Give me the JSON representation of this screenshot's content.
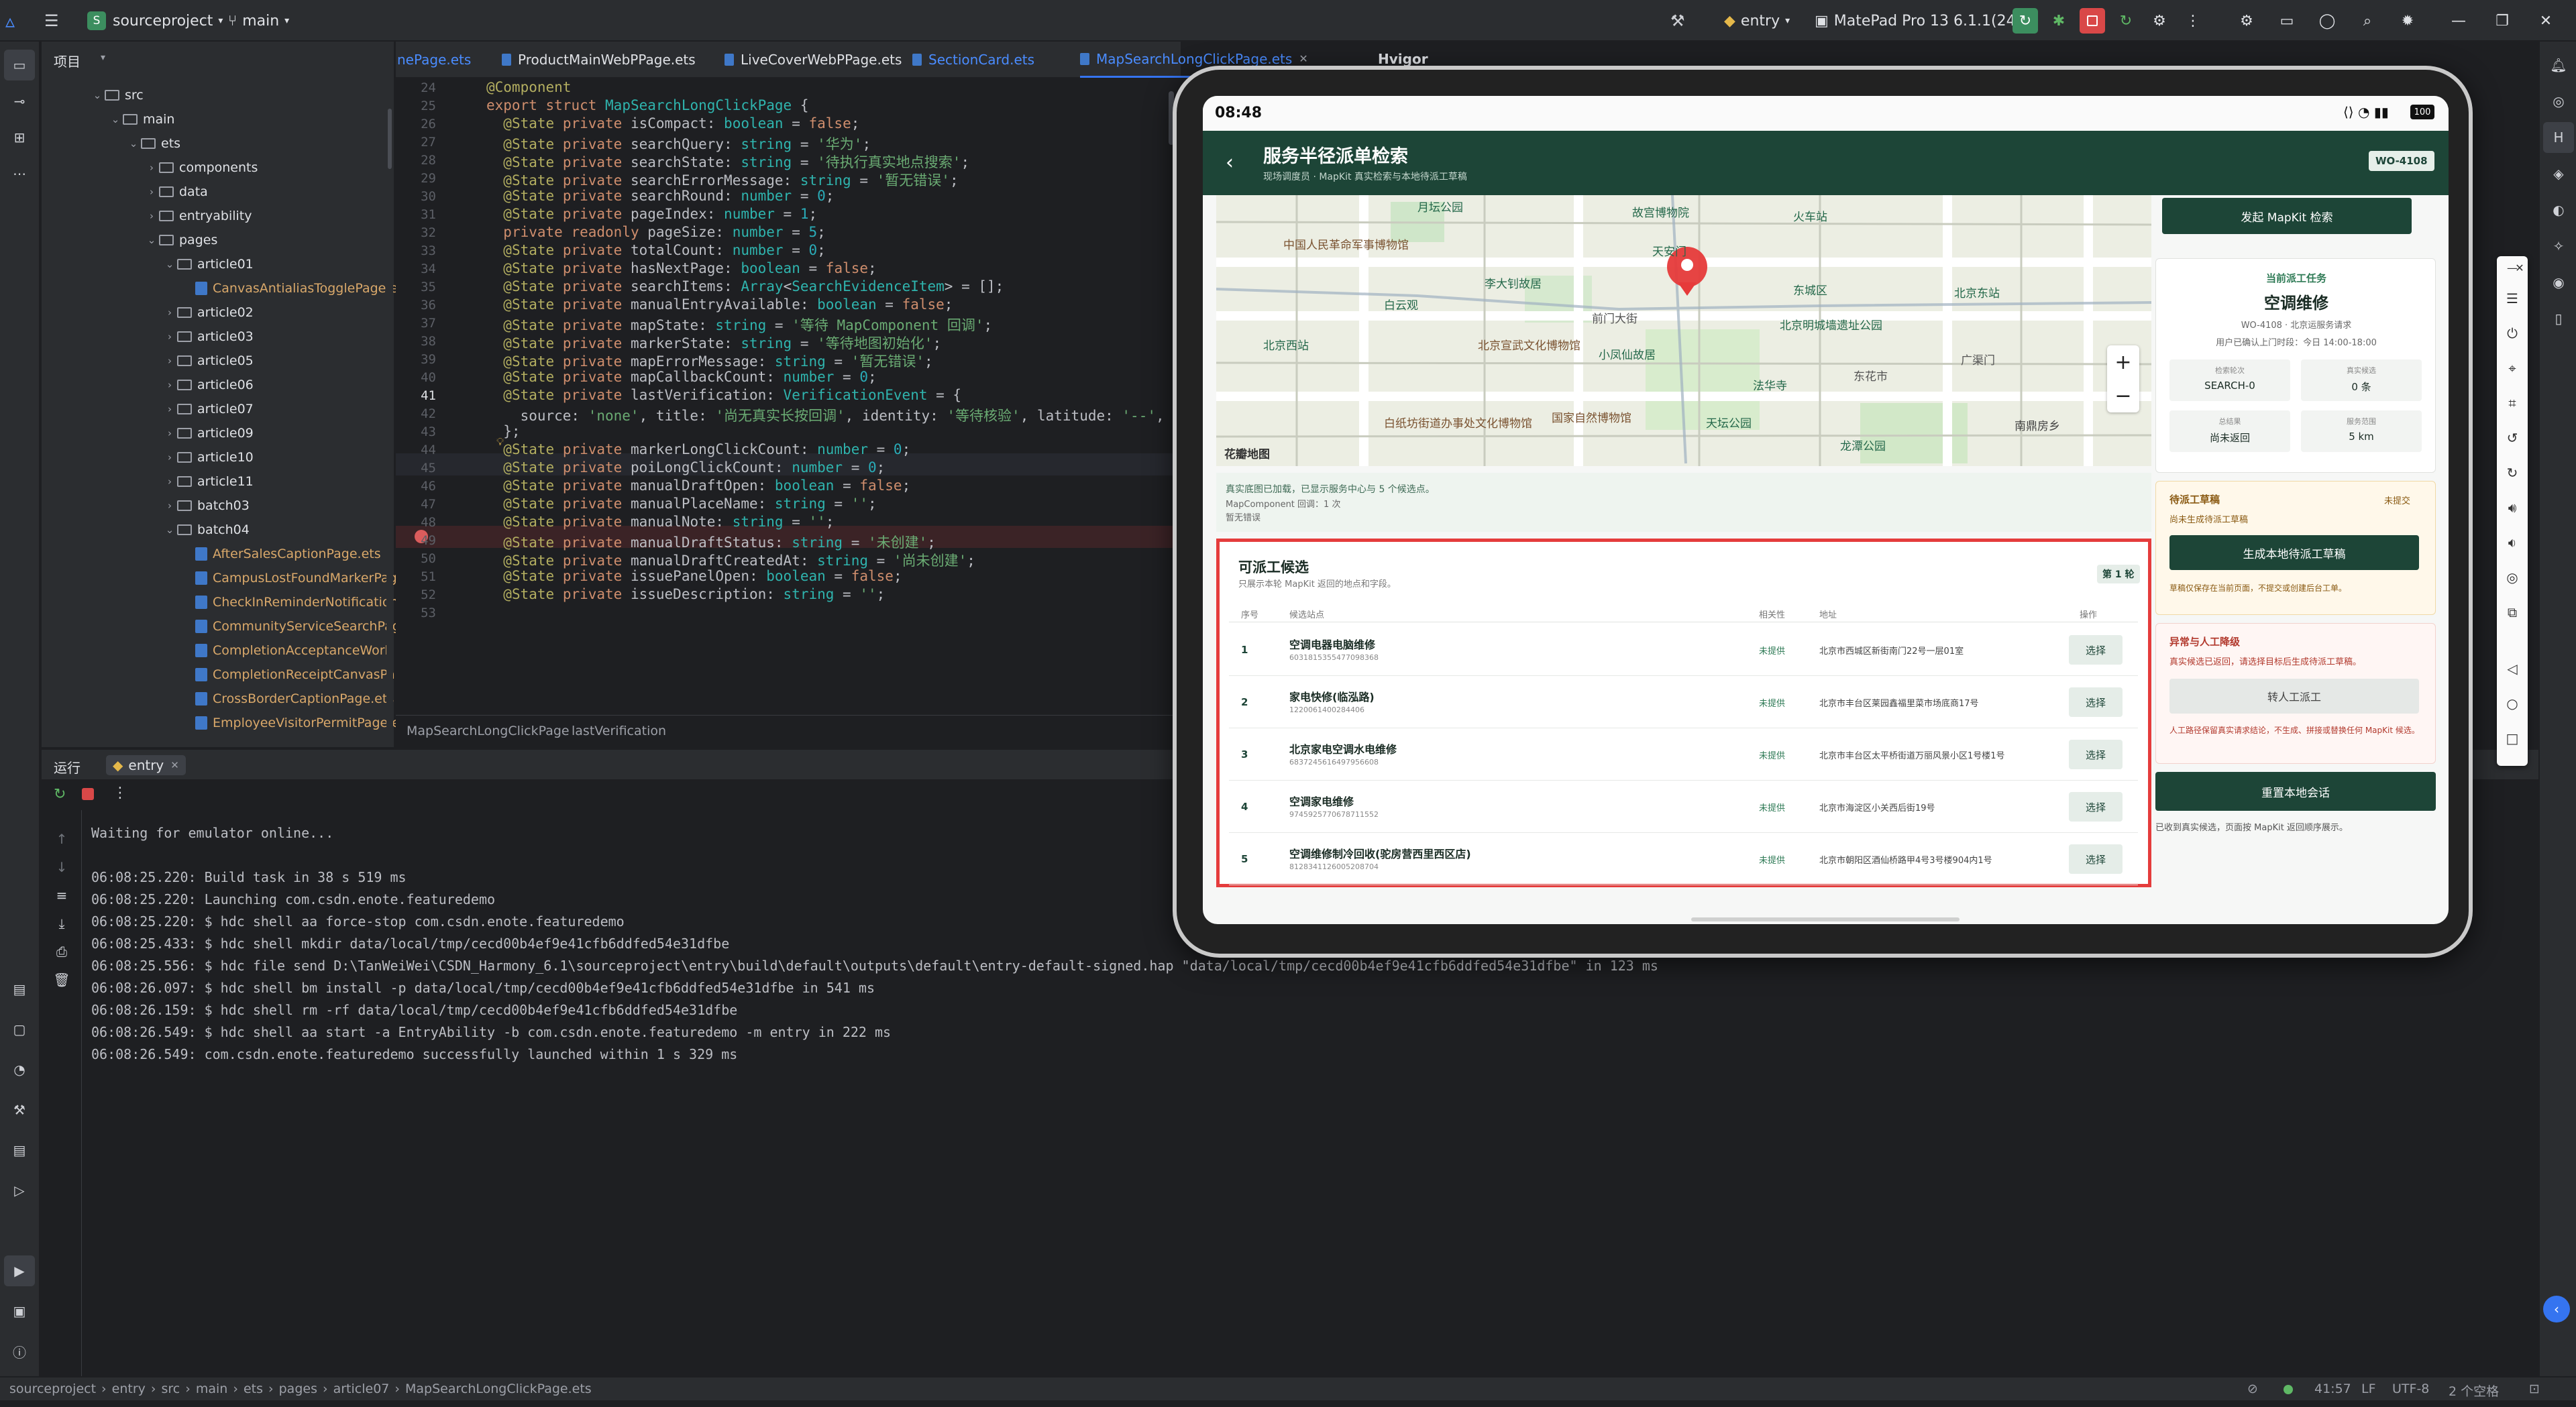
{
  "titlebar": {
    "project": "sourceproject",
    "project_badge": "S",
    "branch": "main",
    "run_config": "entry",
    "device": "MatePad Pro 13 6.1.1(24)"
  },
  "project_panel": {
    "title": "项目",
    "tree": [
      {
        "label": "src",
        "depth": 0,
        "type": "folder",
        "open": true
      },
      {
        "label": "main",
        "depth": 1,
        "type": "folder",
        "open": true
      },
      {
        "label": "ets",
        "depth": 2,
        "type": "folder",
        "open": true
      },
      {
        "label": "components",
        "depth": 3,
        "type": "folder"
      },
      {
        "label": "data",
        "depth": 3,
        "type": "folder"
      },
      {
        "label": "entryability",
        "depth": 3,
        "type": "folder"
      },
      {
        "label": "pages",
        "depth": 3,
        "type": "folder",
        "open": true
      },
      {
        "label": "article01",
        "depth": 4,
        "type": "folder",
        "open": true
      },
      {
        "label": "CanvasAntialiasTogglePage.e",
        "depth": 5,
        "type": "file"
      },
      {
        "label": "article02",
        "depth": 4,
        "type": "folder"
      },
      {
        "label": "article03",
        "depth": 4,
        "type": "folder"
      },
      {
        "label": "article05",
        "depth": 4,
        "type": "folder"
      },
      {
        "label": "article06",
        "depth": 4,
        "type": "folder"
      },
      {
        "label": "article07",
        "depth": 4,
        "type": "folder"
      },
      {
        "label": "article09",
        "depth": 4,
        "type": "folder"
      },
      {
        "label": "article10",
        "depth": 4,
        "type": "folder"
      },
      {
        "label": "article11",
        "depth": 4,
        "type": "folder"
      },
      {
        "label": "batch03",
        "depth": 4,
        "type": "folder"
      },
      {
        "label": "batch04",
        "depth": 4,
        "type": "folder",
        "open": true
      },
      {
        "label": "AfterSalesCaptionPage.ets",
        "depth": 5,
        "type": "file"
      },
      {
        "label": "CampusLostFoundMarkerPag",
        "depth": 5,
        "type": "file"
      },
      {
        "label": "CheckInReminderNotification",
        "depth": 5,
        "type": "file"
      },
      {
        "label": "CommunityServiceSearchPag",
        "depth": 5,
        "type": "file"
      },
      {
        "label": "CompletionAcceptanceWork",
        "depth": 5,
        "type": "file"
      },
      {
        "label": "CompletionReceiptCanvasPa",
        "depth": 5,
        "type": "file"
      },
      {
        "label": "CrossBorderCaptionPage.ets",
        "depth": 5,
        "type": "file"
      },
      {
        "label": "EmployeeVisitorPermitPage.e",
        "depth": 5,
        "type": "file"
      }
    ]
  },
  "tabs": [
    "nePage.ets",
    "ProductMainWebPPage.ets",
    "LiveCoverWebPPage.ets",
    "SectionCard.ets",
    "MapSearchLongClickPage.ets"
  ],
  "active_tab": "MapSearchLongClickPage.ets",
  "hvigor_tab": "Hvigor",
  "editor": {
    "line_numbers": [
      "24",
      "25",
      "26",
      "27",
      "28",
      "29",
      "30",
      "31",
      "32",
      "33",
      "34",
      "35",
      "36",
      "37",
      "38",
      "39",
      "40",
      "41",
      "42",
      "43",
      "44",
      "45",
      "46",
      "47",
      "48",
      "49",
      "50",
      "51",
      "52",
      "53"
    ],
    "lines": [
      "@Component",
      "export struct MapSearchLongClickPage {",
      "  @State private isCompact: boolean = false;",
      "  @State private searchQuery: string = '华为';",
      "  @State private searchState: string = '待执行真实地点搜索';",
      "  @State private searchErrorMessage: string = '暂无错误';",
      "  @State private searchRound: number = 0;",
      "  @State private pageIndex: number = 1;",
      "  private readonly pageSize: number = 5;",
      "  @State private totalCount: number = 0;",
      "  @State private hasNextPage: boolean = false;",
      "  @State private searchItems: Array<SearchEvidenceItem> = [];",
      "  @State private manualEntryAvailable: boolean = false;",
      "  @State private mapState: string = '等待 MapComponent 回调';",
      "  @State private markerState: string = '等待地图初始化';",
      "  @State private mapErrorMessage: string = '暂无错误';",
      "  @State private mapCallbackCount: number = 0;",
      "  @State private lastVerification: VerificationEvent = {",
      "    source: 'none', title: '尚无真实长按回调', identity: '等待核验', latitude: '--', longi",
      "  };",
      "  @State private markerLongClickCount: number = 0;",
      "  @State private poiLongClickCount: number = 0;",
      "  @State private manualDraftOpen: boolean = false;",
      "  @State private manualPlaceName: string = '';",
      "  @State private manualNote: string = '';",
      "  @State private manualDraftStatus: string = '未创建';",
      "  @State private manualDraftCreatedAt: string = '尚未创建';",
      "  @State private issuePanelOpen: boolean = false;",
      "  @State private issueDescription: string = '';",
      ""
    ],
    "current_line": "41",
    "breakpoint_line": "44"
  },
  "breadcrumb": [
    "MapSearchLongClickPage",
    "lastVerification"
  ],
  "run_panel": {
    "tab_label": "运行",
    "config": "entry",
    "lines": [
      "Waiting for emulator online...",
      "",
      "06:08:25.220: Build task in 38 s 519 ms",
      "06:08:25.220: Launching com.csdn.enote.featuredemo",
      "06:08:25.220: $ hdc shell aa force-stop com.csdn.enote.featuredemo",
      "06:08:25.433: $ hdc shell mkdir data/local/tmp/cecd00b4ef9e41cfb6ddfed54e31dfbe",
      "06:08:25.556: $ hdc file send D:\\TanWeiWei\\CSDN_Harmony_6.1\\sourceproject\\entry\\build\\default\\outputs\\default\\entry-default-signed.hap \"data/local/tmp/cecd00b4ef9e41cfb6ddfed54e31dfbe\" in 123 ms",
      "06:08:26.097: $ hdc shell bm install -p data/local/tmp/cecd00b4ef9e41cfb6ddfed54e31dfbe in 541 ms",
      "06:08:26.159: $ hdc shell rm -rf data/local/tmp/cecd00b4ef9e41cfb6ddfed54e31dfbe",
      "06:08:26.549: $ hdc shell aa start -a EntryAbility -b com.csdn.enote.featuredemo -m entry in 222 ms",
      "06:08:26.549: com.csdn.enote.featuredemo successfully launched within 1 s 329 ms"
    ]
  },
  "statusbar": {
    "path": [
      "sourceproject",
      "entry",
      "src",
      "main",
      "ets",
      "pages",
      "article07",
      "MapSearchLongClickPage.ets"
    ],
    "position": "41:57",
    "line_sep": "LF",
    "encoding": "UTF-8",
    "indent": "2 个空格"
  },
  "device": {
    "time": "08:48",
    "battery": "100",
    "app_title": "服务半径派单检索",
    "app_subtitle": "现场调度员 · MapKit 真实检索与本地待派工草稿",
    "order_badge": "WO-4108",
    "map_labels": [
      "月坛公园",
      "故宫博物院",
      "中国人民革命军事博物馆",
      "天安门",
      "李大钊故居",
      "火车站",
      "东城区",
      "白云观",
      "北京西站",
      "北京宣武文化博物馆",
      "小凤仙故居",
      "北京明城墙遗址公园",
      "北京东站",
      "广渠门",
      "法华寺",
      "国家自然博物馆",
      "天坛公园",
      "白纸坊街道办事处文化博物馆",
      "龙潭公园",
      "南鼎房乡",
      "花瓣地图",
      "前门大街",
      "东花市"
    ],
    "map_zoom_in": "+",
    "map_zoom_out": "−",
    "notice_line1": "真实底图已加载，已显示服务中心与 5 个候选点。",
    "notice_line2": "MapComponent 回调：1 次",
    "notice_line3": "暂无错误",
    "candidates": {
      "title": "可派工候选",
      "subtitle": "只展示本轮 MapKit 返回的地点和字段。",
      "round_badge": "第 1 轮",
      "headers": [
        "序号",
        "候选站点",
        "相关性",
        "地址",
        "操作"
      ],
      "rows": [
        {
          "no": "1",
          "name": "空调电器电脑维修",
          "id": "6031815355477098368",
          "relevance": "未提供",
          "address": "北京市西城区新街南门22号一层01室",
          "action": "选择"
        },
        {
          "no": "2",
          "name": "家电快修(临泓路)",
          "id": "1220061400284406",
          "relevance": "未提供",
          "address": "北京市丰台区莱园鑫福里菜市场底商17号",
          "action": "选择"
        },
        {
          "no": "3",
          "name": "北京家电空调水电维修",
          "id": "6837245616497956608",
          "relevance": "未提供",
          "address": "北京市丰台区太平桥街道万丽风景小区1号楼1号",
          "action": "选择"
        },
        {
          "no": "4",
          "name": "空调家电维修",
          "id": "9745925770678711552",
          "relevance": "未提供",
          "address": "北京市海淀区小关西后街19号",
          "action": "选择"
        },
        {
          "no": "5",
          "name": "空调维修制冷回收(驼房营西里西区店)",
          "id": "8128341126005208704",
          "relevance": "未提供",
          "address": "北京市朝阳区酒仙桥路甲4号3号楼904内1号",
          "action": "选择"
        }
      ]
    },
    "side": {
      "search_button": "发起 MapKit 检索",
      "task_kicker": "当前派工任务",
      "task_title": "空调维修",
      "task_meta1": "WO-4108 · 北京运服务请求",
      "task_meta2": "用户已确认上门时段：今日 14:00-18:00",
      "stats": [
        {
          "label": "检索轮次",
          "value": "SEARCH-0"
        },
        {
          "label": "真实候选",
          "value": "0 条"
        },
        {
          "label": "总结果",
          "value": "尚未返回"
        },
        {
          "label": "服务范围",
          "value": "5 km"
        }
      ],
      "draft_title": "待派工草稿",
      "draft_state": "未提交",
      "draft_desc": "尚未生成待派工草稿",
      "draft_button": "生成本地待派工草稿",
      "draft_note": "草稿仅保存在当前页面，不提交或创建后台工单。",
      "issue_title": "异常与人工降级",
      "issue_desc": "真实候选已返回，请选择目标后生成待派工草稿。",
      "issue_button": "转人工派工",
      "issue_note": "人工路径保留真实请求结论，不生成、拼接或替换任何 MapKit 候选。",
      "reset_button": "重置本地会话",
      "footer": "已收到真实候选，页面按 MapKit 返回顺序展示。"
    }
  }
}
